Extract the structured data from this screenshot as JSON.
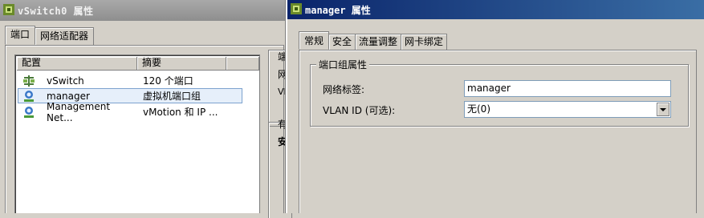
{
  "back_window": {
    "title": "vSwitch0 属性",
    "tabs": [
      "端口",
      "网络适配器"
    ],
    "list": {
      "columns": [
        "配置",
        "摘要"
      ],
      "rows": [
        {
          "config": "vSwitch",
          "summary": "120 个端口",
          "icon": "vswitch-icon"
        },
        {
          "config": "manager",
          "summary": "虚拟机端口组",
          "icon": "vm-portgroup-icon"
        },
        {
          "config": "Management Net...",
          "summary": "vMotion 和 IP ...",
          "icon": "vmkernel-port-icon"
        }
      ]
    },
    "right_fragments": [
      "端",
      "网",
      "VI",
      "有",
      "安"
    ]
  },
  "front_window": {
    "title": "manager 属性",
    "tabs": [
      "常规",
      "安全",
      "流量调整",
      "网卡绑定"
    ],
    "group_title": "端口组属性",
    "network_label": {
      "label": "网络标签:",
      "value": "manager"
    },
    "vlan_id": {
      "label": "VLAN ID (可选):",
      "value": "无(0)"
    }
  }
}
